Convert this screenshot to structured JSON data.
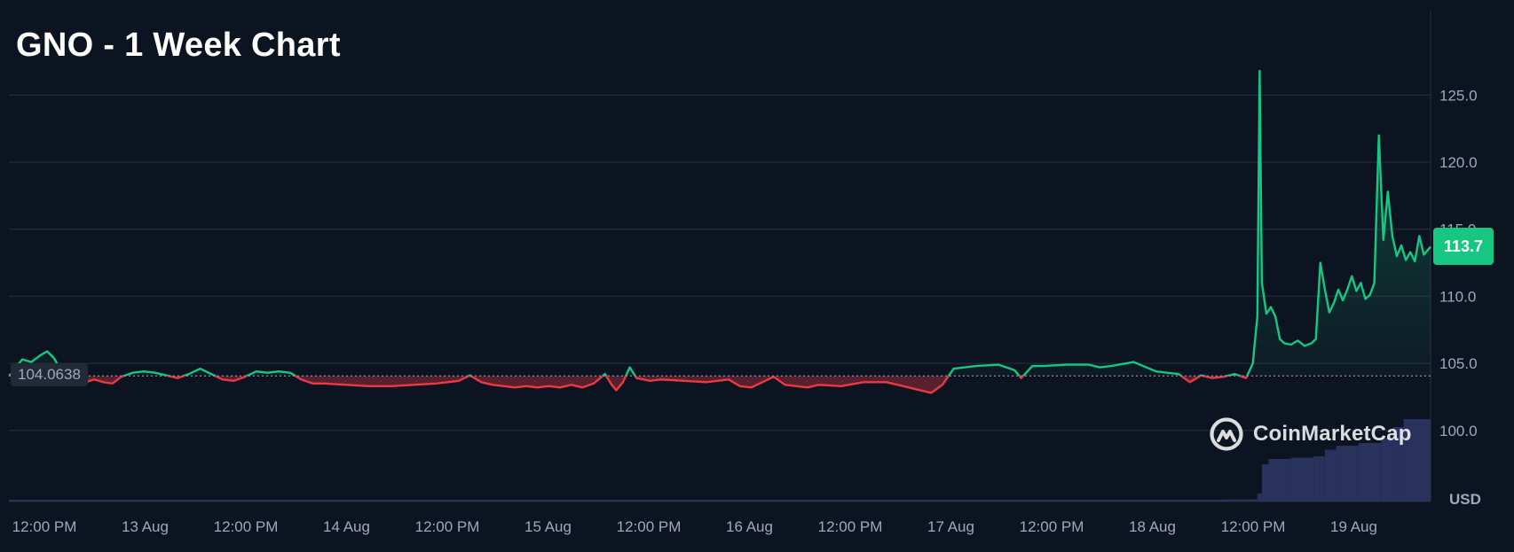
{
  "chart_data": {
    "type": "line",
    "title": "GNO - 1 Week Chart",
    "currency_label": "USD",
    "y_ticks": [
      100.0,
      105.0,
      110.0,
      115.0,
      120.0,
      125.0
    ],
    "ylim": [
      94.7,
      131.3
    ],
    "x_tick_labels": [
      "12:00 PM",
      "13 Aug",
      "12:00 PM",
      "14 Aug",
      "12:00 PM",
      "15 Aug",
      "12:00 PM",
      "16 Aug",
      "12:00 PM",
      "17 Aug",
      "12:00 PM",
      "18 Aug",
      "12:00 PM",
      "19 Aug"
    ],
    "reference_price": "104.0638",
    "reference_value": 104.0638,
    "current_price": "113.7",
    "grid": true,
    "watermark": "CoinMarketCap",
    "colors": {
      "background": "#0d1421",
      "up": "#16c784",
      "down": "#ea3943",
      "grid": "#222b3b",
      "axis_text": "#a1a7bb",
      "volume": "#2b3563"
    },
    "price_series": [
      [
        0.0,
        104.1
      ],
      [
        0.2,
        104.3
      ],
      [
        0.35,
        104.8
      ],
      [
        0.6,
        105.3
      ],
      [
        1.0,
        105.1
      ],
      [
        1.4,
        105.6
      ],
      [
        1.7,
        105.9
      ],
      [
        2.0,
        105.4
      ],
      [
        2.3,
        104.5
      ],
      [
        2.7,
        104.2
      ],
      [
        3.0,
        103.8
      ],
      [
        3.4,
        103.6
      ],
      [
        3.8,
        103.8
      ],
      [
        4.2,
        103.6
      ],
      [
        4.6,
        103.5
      ],
      [
        5.0,
        104.0
      ],
      [
        5.5,
        104.3
      ],
      [
        6.0,
        104.4
      ],
      [
        6.5,
        104.3
      ],
      [
        7.0,
        104.1
      ],
      [
        7.5,
        103.9
      ],
      [
        8.0,
        104.2
      ],
      [
        8.5,
        104.6
      ],
      [
        9.0,
        104.2
      ],
      [
        9.5,
        103.8
      ],
      [
        10.0,
        103.7
      ],
      [
        10.5,
        104.0
      ],
      [
        11.0,
        104.4
      ],
      [
        11.5,
        104.3
      ],
      [
        12.0,
        104.4
      ],
      [
        12.5,
        104.3
      ],
      [
        13.0,
        103.8
      ],
      [
        13.5,
        103.5
      ],
      [
        14.0,
        103.5
      ],
      [
        15.0,
        103.4
      ],
      [
        16.0,
        103.3
      ],
      [
        17.0,
        103.3
      ],
      [
        18.0,
        103.4
      ],
      [
        19.0,
        103.5
      ],
      [
        20.0,
        103.7
      ],
      [
        20.5,
        104.1
      ],
      [
        21.0,
        103.6
      ],
      [
        21.5,
        103.4
      ],
      [
        22.0,
        103.3
      ],
      [
        22.5,
        103.2
      ],
      [
        23.0,
        103.3
      ],
      [
        23.5,
        103.2
      ],
      [
        24.0,
        103.3
      ],
      [
        24.5,
        103.2
      ],
      [
        25.0,
        103.4
      ],
      [
        25.5,
        103.2
      ],
      [
        26.0,
        103.5
      ],
      [
        26.5,
        104.2
      ],
      [
        26.8,
        103.4
      ],
      [
        27.0,
        103.0
      ],
      [
        27.3,
        103.6
      ],
      [
        27.6,
        104.7
      ],
      [
        27.9,
        103.9
      ],
      [
        28.5,
        103.7
      ],
      [
        29.0,
        103.8
      ],
      [
        30.0,
        103.7
      ],
      [
        31.0,
        103.6
      ],
      [
        32.0,
        103.8
      ],
      [
        32.5,
        103.3
      ],
      [
        33.0,
        103.2
      ],
      [
        33.5,
        103.6
      ],
      [
        34.0,
        104.0
      ],
      [
        34.5,
        103.4
      ],
      [
        35.0,
        103.3
      ],
      [
        35.5,
        103.2
      ],
      [
        36.0,
        103.4
      ],
      [
        37.0,
        103.3
      ],
      [
        38.0,
        103.6
      ],
      [
        39.0,
        103.6
      ],
      [
        40.0,
        103.2
      ],
      [
        41.0,
        102.8
      ],
      [
        41.5,
        103.4
      ],
      [
        42.0,
        104.6
      ],
      [
        43.0,
        104.8
      ],
      [
        44.0,
        104.9
      ],
      [
        44.7,
        104.5
      ],
      [
        45.0,
        103.9
      ],
      [
        45.5,
        104.8
      ],
      [
        46.0,
        104.8
      ],
      [
        47.0,
        104.9
      ],
      [
        48.0,
        104.9
      ],
      [
        48.5,
        104.7
      ],
      [
        49.0,
        104.8
      ],
      [
        50.0,
        105.1
      ],
      [
        51.0,
        104.4
      ],
      [
        52.0,
        104.2
      ],
      [
        52.5,
        103.6
      ],
      [
        53.0,
        104.1
      ],
      [
        53.5,
        103.9
      ],
      [
        54.0,
        104.0
      ],
      [
        54.5,
        104.2
      ],
      [
        55.0,
        103.9
      ],
      [
        55.3,
        105.0
      ],
      [
        55.5,
        108.5
      ],
      [
        55.6,
        126.8
      ],
      [
        55.7,
        111.0
      ],
      [
        55.9,
        108.7
      ],
      [
        56.1,
        109.2
      ],
      [
        56.3,
        108.5
      ],
      [
        56.5,
        106.8
      ],
      [
        56.7,
        106.5
      ],
      [
        57.0,
        106.4
      ],
      [
        57.3,
        106.7
      ],
      [
        57.6,
        106.3
      ],
      [
        57.9,
        106.5
      ],
      [
        58.1,
        106.8
      ],
      [
        58.3,
        112.5
      ],
      [
        58.5,
        110.5
      ],
      [
        58.7,
        108.8
      ],
      [
        58.9,
        109.5
      ],
      [
        59.1,
        110.5
      ],
      [
        59.3,
        109.7
      ],
      [
        59.5,
        110.5
      ],
      [
        59.7,
        111.5
      ],
      [
        59.9,
        110.4
      ],
      [
        60.1,
        111.0
      ],
      [
        60.3,
        109.8
      ],
      [
        60.5,
        110.1
      ],
      [
        60.7,
        111.0
      ],
      [
        60.9,
        122.0
      ],
      [
        61.1,
        114.2
      ],
      [
        61.3,
        117.8
      ],
      [
        61.5,
        114.5
      ],
      [
        61.7,
        113.0
      ],
      [
        61.9,
        113.8
      ],
      [
        62.1,
        112.7
      ],
      [
        62.3,
        113.3
      ],
      [
        62.5,
        112.6
      ],
      [
        62.7,
        114.5
      ],
      [
        62.9,
        113.1
      ],
      [
        63.2,
        113.7
      ]
    ],
    "volume_series": [
      [
        0.0,
        0.008
      ],
      [
        2.0,
        0.011
      ],
      [
        4.0,
        0.006
      ],
      [
        6.0,
        0.011
      ],
      [
        8.0,
        0.007
      ],
      [
        10.0,
        0.004
      ],
      [
        12.0,
        0.005
      ],
      [
        14.0,
        0.004
      ],
      [
        16.0,
        0.003
      ],
      [
        18.0,
        0.004
      ],
      [
        20.0,
        0.003
      ],
      [
        22.0,
        0.004
      ],
      [
        24.0,
        0.003
      ],
      [
        26.0,
        0.005
      ],
      [
        28.0,
        0.01
      ],
      [
        30.0,
        0.008
      ],
      [
        32.0,
        0.007
      ],
      [
        34.0,
        0.009
      ],
      [
        36.0,
        0.004
      ],
      [
        38.0,
        0.003
      ],
      [
        40.0,
        0.004
      ],
      [
        42.0,
        0.008
      ],
      [
        44.0,
        0.009
      ],
      [
        46.0,
        0.007
      ],
      [
        48.0,
        0.008
      ],
      [
        50.0,
        0.006
      ],
      [
        52.0,
        0.005
      ],
      [
        53.0,
        0.009
      ],
      [
        54.0,
        0.015
      ],
      [
        55.0,
        0.016
      ],
      [
        55.5,
        0.06
      ],
      [
        55.7,
        0.28
      ],
      [
        56.0,
        0.32
      ],
      [
        57.0,
        0.33
      ],
      [
        58.0,
        0.34
      ],
      [
        58.5,
        0.39
      ],
      [
        59.0,
        0.42
      ],
      [
        60.0,
        0.44
      ],
      [
        61.0,
        0.48
      ],
      [
        61.5,
        0.56
      ],
      [
        62.0,
        0.62
      ],
      [
        63.2,
        0.64
      ]
    ]
  }
}
